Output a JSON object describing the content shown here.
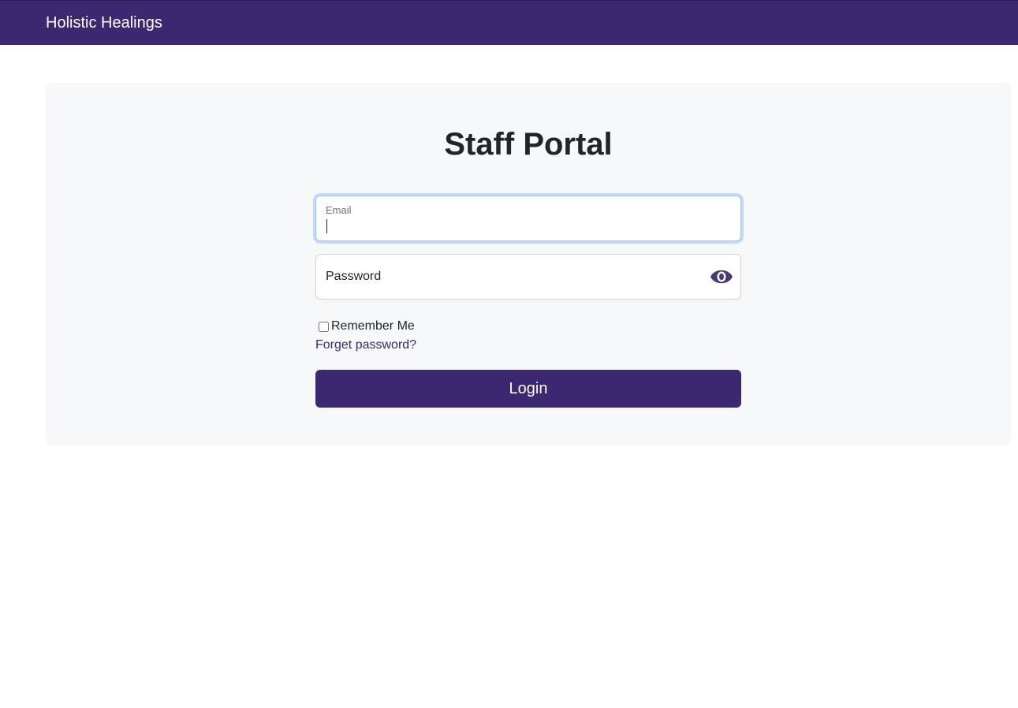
{
  "navbar": {
    "brand": "Holistic Healings",
    "bg_color": "#3b2870"
  },
  "login_card": {
    "title": "Staff Portal",
    "email": {
      "label": "Email",
      "value": "",
      "focused": true
    },
    "password": {
      "placeholder": "Password",
      "value": "",
      "toggle_icon": "eye-icon"
    },
    "remember_me": {
      "label": "Remember Me",
      "checked": false
    },
    "forgot_link": "Forget password?",
    "login_button": "Login"
  },
  "colors": {
    "primary": "#3b2870",
    "card_bg": "#f7f8fa",
    "focus_border": "#9ec5fe"
  }
}
